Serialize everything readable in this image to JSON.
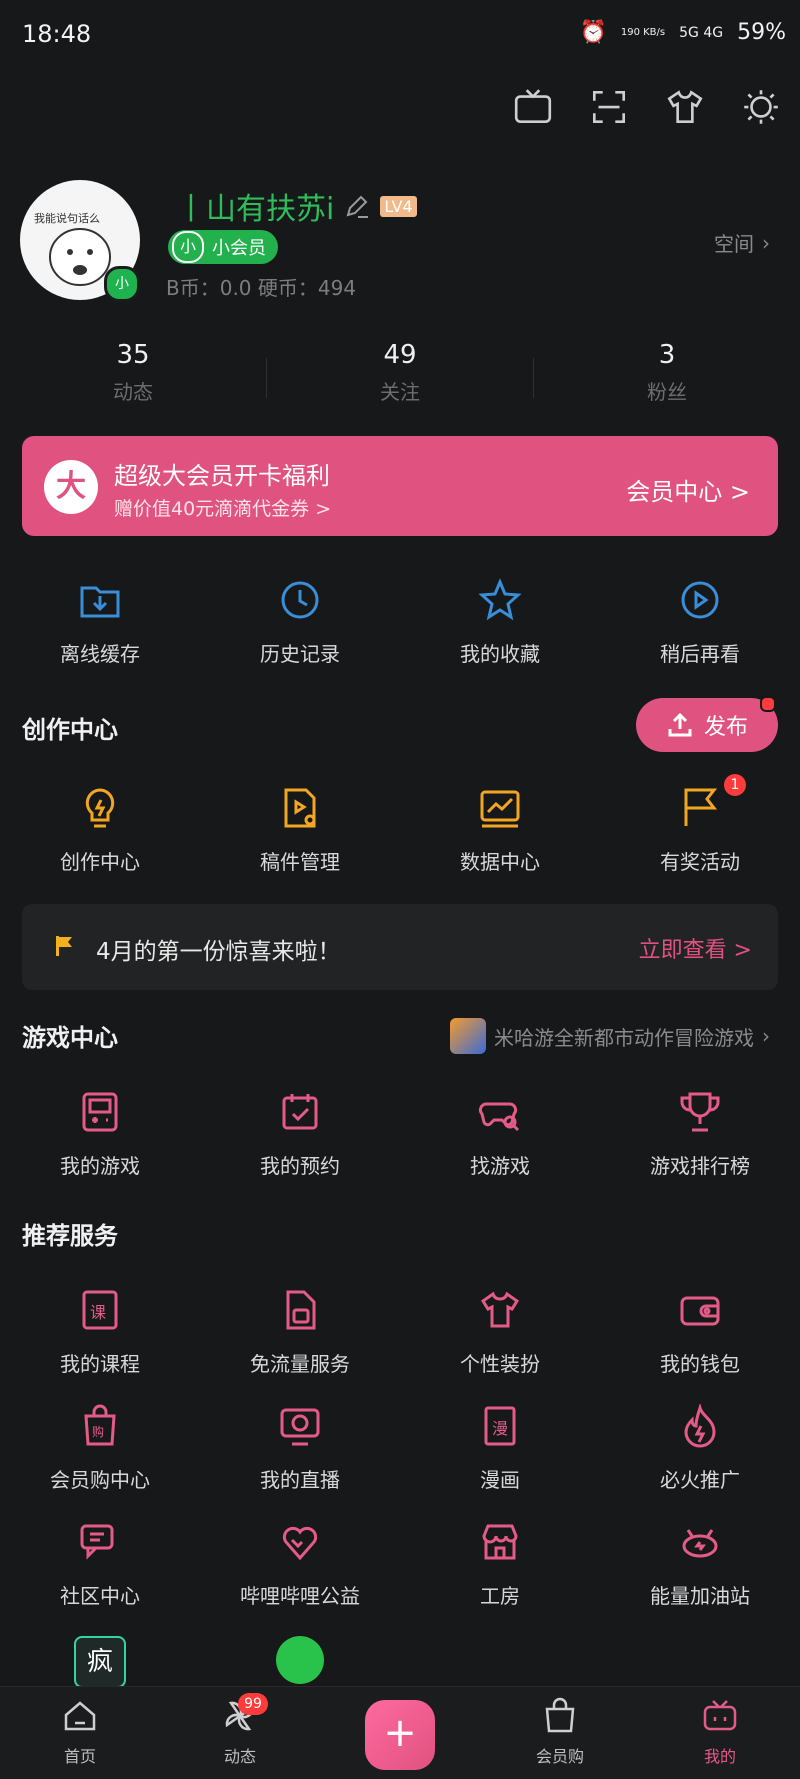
{
  "status": {
    "time": "18:48",
    "speed": "190 KB/s",
    "network": "5G 4G",
    "battery": "59%"
  },
  "profile": {
    "name": "丨山有扶苏i",
    "level": "LV4",
    "avatar_caption": "我能说句话么",
    "avatar_badge": "小",
    "member_label": "小会员",
    "coins": "B币：0.0    硬币：494",
    "space": "空间"
  },
  "stats": [
    {
      "value": "35",
      "label": "动态"
    },
    {
      "value": "49",
      "label": "关注"
    },
    {
      "value": "3",
      "label": "粉丝"
    }
  ],
  "vip": {
    "icon": "大",
    "title": "超级大会员开卡福利",
    "subtitle": "赠价值40元滴滴代金券 >",
    "link": "会员中心 >"
  },
  "quick": [
    {
      "icon": "download-folder-icon",
      "label": "离线缓存"
    },
    {
      "icon": "history-icon",
      "label": "历史记录"
    },
    {
      "icon": "star-icon",
      "label": "我的收藏"
    },
    {
      "icon": "watch-later-icon",
      "label": "稍后再看"
    }
  ],
  "creation": {
    "title": "创作中心",
    "publish": "发布",
    "items": [
      {
        "icon": "lightbulb-icon",
        "label": "创作中心"
      },
      {
        "icon": "manuscript-icon",
        "label": "稿件管理"
      },
      {
        "icon": "data-chart-icon",
        "label": "数据中心"
      },
      {
        "icon": "flag-icon",
        "label": "有奖活动",
        "badge": "1"
      }
    ]
  },
  "banner": {
    "text": "4月的第一份惊喜来啦！",
    "action": "立即查看 >"
  },
  "games": {
    "title": "游戏中心",
    "hint": "米哈游全新都市动作冒险游戏",
    "items": [
      {
        "icon": "gameboy-icon",
        "label": "我的游戏"
      },
      {
        "icon": "calendar-check-icon",
        "label": "我的预约"
      },
      {
        "icon": "gamepad-search-icon",
        "label": "找游戏"
      },
      {
        "icon": "trophy-icon",
        "label": "游戏排行榜"
      }
    ]
  },
  "services": {
    "title": "推荐服务",
    "rows": [
      [
        {
          "icon": "course-book-icon",
          "label": "我的课程"
        },
        {
          "icon": "sim-card-icon",
          "label": "免流量服务"
        },
        {
          "icon": "tshirt-icon",
          "label": "个性装扮"
        },
        {
          "icon": "wallet-icon",
          "label": "我的钱包"
        }
      ],
      [
        {
          "icon": "shopping-bag-icon",
          "label": "会员购中心"
        },
        {
          "icon": "live-tv-icon",
          "label": "我的直播"
        },
        {
          "icon": "manga-icon",
          "label": "漫画"
        },
        {
          "icon": "fire-icon",
          "label": "必火推广"
        }
      ],
      [
        {
          "icon": "chat-bubbles-icon",
          "label": "社区中心"
        },
        {
          "icon": "heart-hands-icon",
          "label": "哔哩哔哩公益"
        },
        {
          "icon": "shop-icon",
          "label": "工房"
        },
        {
          "icon": "energy-station-icon",
          "label": "能量加油站"
        }
      ]
    ],
    "last_row": [
      {
        "icon": "crazy-app-icon",
        "text": "疯"
      },
      {
        "icon": "green-smile-icon"
      }
    ]
  },
  "tabs": [
    {
      "icon": "home-icon",
      "label": "首页"
    },
    {
      "icon": "pinwheel-icon",
      "label": "动态",
      "badge": "99"
    },
    {
      "icon": "plus-icon",
      "label": "+"
    },
    {
      "icon": "shopping-bag-icon",
      "label": "会员购"
    },
    {
      "icon": "bilibili-tv-icon",
      "label": "我的"
    }
  ],
  "colors": {
    "accent": "#e0527f",
    "green": "#22b14c",
    "blue": "#3a8ed8",
    "orange": "#f3a623"
  }
}
